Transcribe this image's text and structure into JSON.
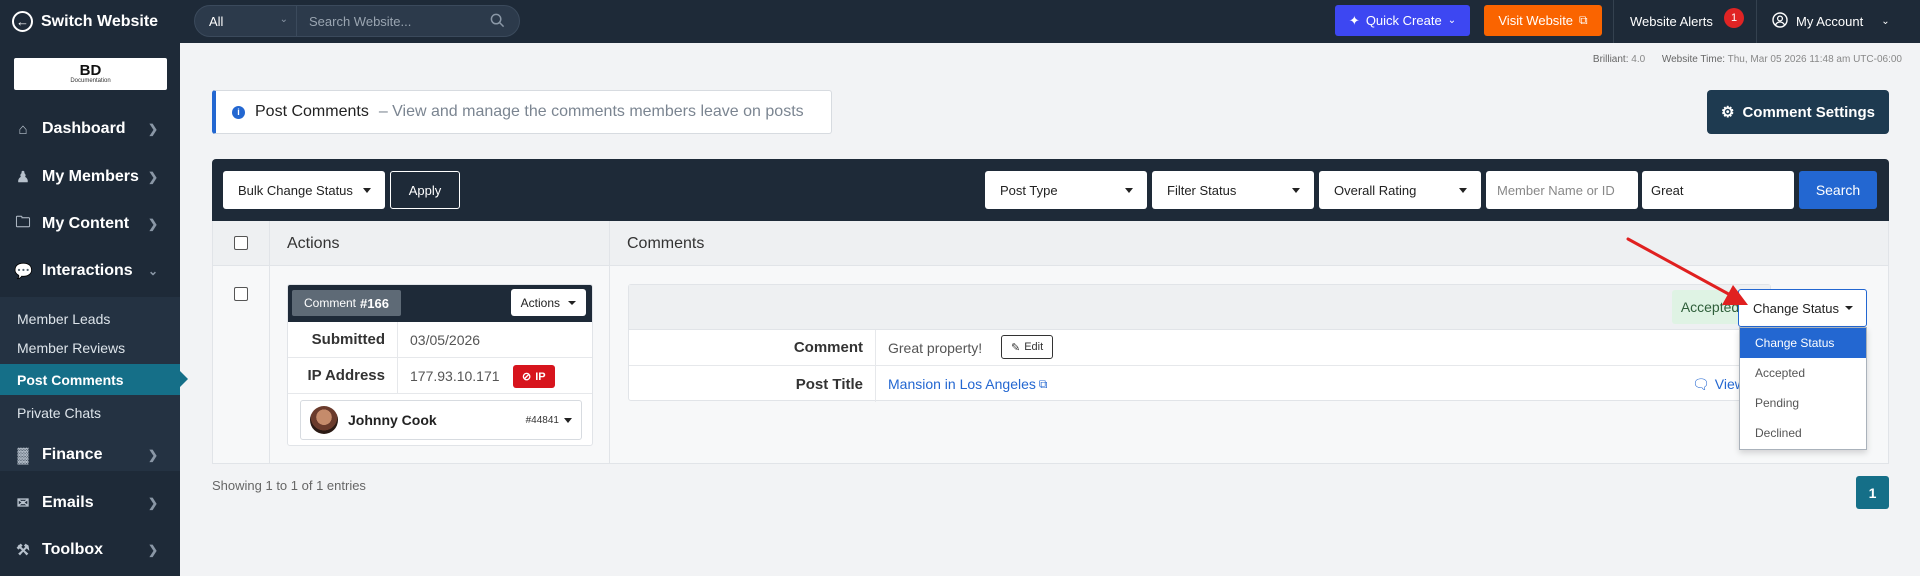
{
  "topbar": {
    "switch_label": "Switch Website",
    "search_scope": "All",
    "search_placeholder": "Search Website...",
    "quick_create": "Quick Create",
    "visit_website": "Visit Website",
    "alerts_label": "Website Alerts",
    "alerts_count": "1",
    "account_label": "My Account"
  },
  "logo": {
    "text": "BD",
    "subtext": "Documentation"
  },
  "sidebar": {
    "items": [
      {
        "label": "Dashboard"
      },
      {
        "label": "My Members"
      },
      {
        "label": "My Content"
      },
      {
        "label": "Interactions"
      },
      {
        "label": "Finance"
      },
      {
        "label": "Emails"
      },
      {
        "label": "Toolbox"
      }
    ],
    "sub_items": [
      {
        "label": "Member Leads"
      },
      {
        "label": "Member Reviews"
      },
      {
        "label": "Post Comments"
      },
      {
        "label": "Private Chats"
      }
    ]
  },
  "meta": {
    "version_label": "Brilliant:",
    "version": "4.0",
    "time_label": "Website Time:",
    "time": "Thu, Mar 05 2026 11:48 am UTC-06:00"
  },
  "page": {
    "title": "Post Comments",
    "subtitle": "– View and manage the comments members leave on posts",
    "settings_button": "Comment Settings"
  },
  "filters": {
    "bulk_status": "Bulk Change Status",
    "apply": "Apply",
    "post_type": "Post Type",
    "filter_status": "Filter Status",
    "overall_rating": "Overall Rating",
    "member_placeholder": "Member Name or ID",
    "keyword": "Great",
    "search": "Search"
  },
  "table": {
    "col_actions": "Actions",
    "col_comments": "Comments",
    "row": {
      "comment_tag": "Comment",
      "comment_id": "#166",
      "actions_label": "Actions",
      "submitted_label": "Submitted",
      "submitted": "03/05/2026",
      "ip_label": "IP Address",
      "ip": "177.93.10.171",
      "ip_button": "IP",
      "member_name": "Johnny Cook",
      "member_id": "#44841",
      "status": "Accepted",
      "comment_label": "Comment",
      "comment_text": "Great property!",
      "edit": "Edit",
      "post_title_label": "Post Title",
      "post_title": "Mansion in Los Angeles",
      "view": "View"
    }
  },
  "status_dropdown": {
    "button": "Change Status",
    "options": [
      "Change Status",
      "Accepted",
      "Pending",
      "Declined"
    ],
    "selected": "Change Status"
  },
  "footer": {
    "showing": "Showing 1 to 1 of 1 entries",
    "page": "1"
  },
  "colors": {
    "sidebar": "#1e2a38",
    "active_nav": "#156f88",
    "primary": "#2367d1",
    "quick_create": "#3d47f2",
    "visit_website": "#fa6400",
    "ip_button": "#d7141d",
    "annotation_arrow": "#e02020"
  }
}
